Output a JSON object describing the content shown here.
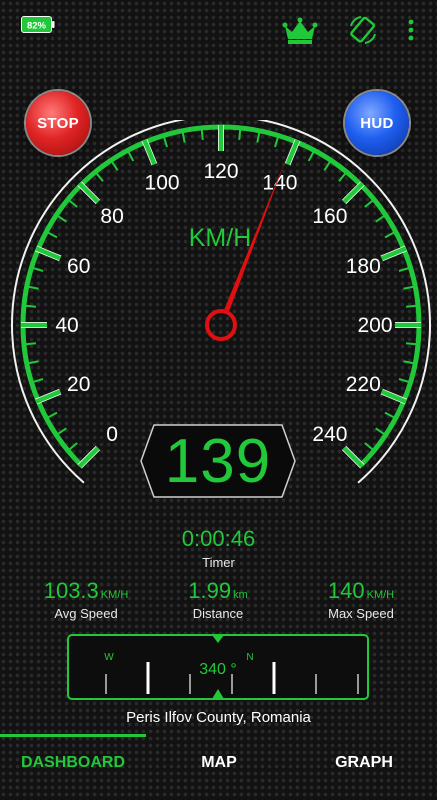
{
  "status_bar": {
    "battery_level": "82%",
    "icons": [
      "battery-icon",
      "crown-icon",
      "screen-rotate-icon",
      "more-vert-icon"
    ]
  },
  "controls": {
    "stop_label": "STOP",
    "hud_label": "HUD"
  },
  "gauge": {
    "unit_label": "KM/H",
    "tick_labels": [
      "0",
      "20",
      "40",
      "60",
      "80",
      "100",
      "120",
      "140",
      "160",
      "180",
      "200",
      "220",
      "240"
    ],
    "min": 0,
    "max": 240,
    "current_speed": 139,
    "speed_display": "139",
    "accent_color": "#21c93a",
    "needle_color": "#e01010"
  },
  "timer": {
    "value": "0:00:46",
    "label": "Timer"
  },
  "stats": {
    "avg_speed": {
      "value": "103.3",
      "unit": "KM/H",
      "label": "Avg Speed"
    },
    "distance": {
      "value": "1.99",
      "unit": "km",
      "label": "Distance"
    },
    "max_speed": {
      "value": "140",
      "unit": "KM/H",
      "label": "Max Speed"
    }
  },
  "compass": {
    "heading": "340 °",
    "heading_degrees": 340,
    "cardinals": [
      "W",
      "N"
    ]
  },
  "location": {
    "text": "Peris Ilfov County, Romania"
  },
  "tabs": [
    {
      "label": "DASHBOARD",
      "active": true
    },
    {
      "label": "MAP",
      "active": false
    },
    {
      "label": "GRAPH",
      "active": false
    }
  ]
}
